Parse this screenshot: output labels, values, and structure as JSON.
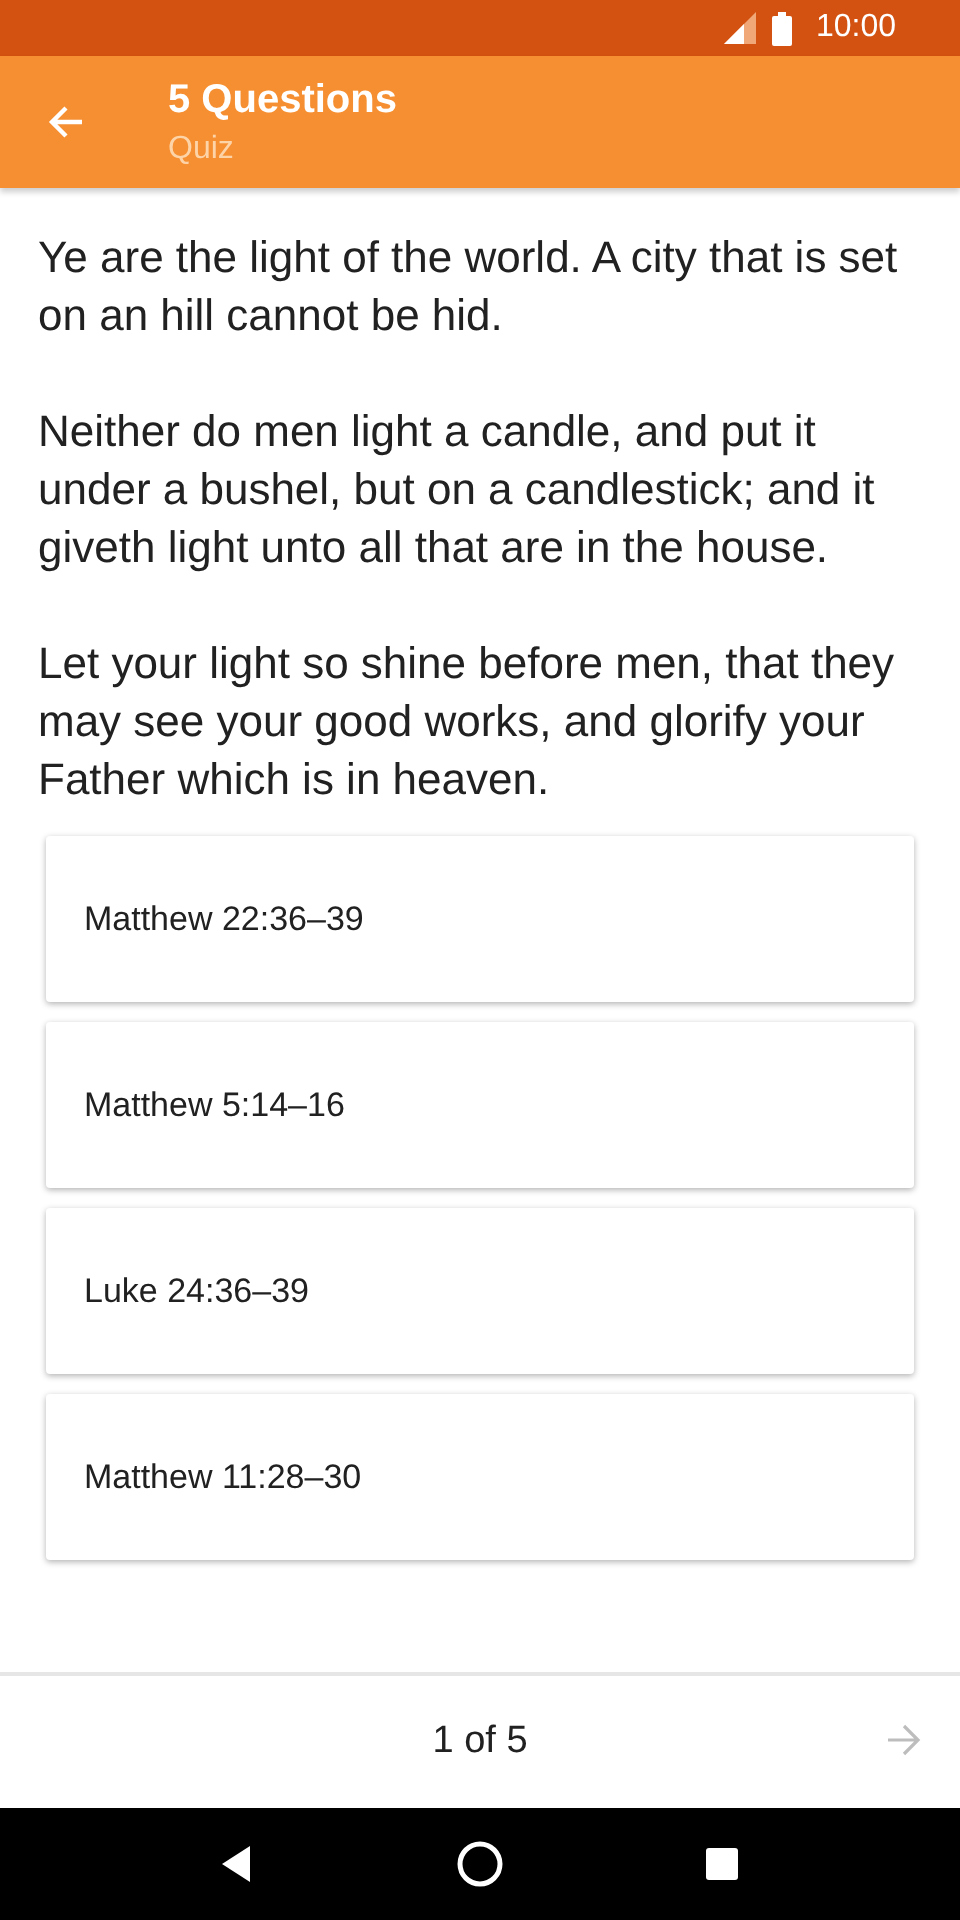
{
  "status_bar": {
    "time": "10:00"
  },
  "app_bar": {
    "title": "5 Questions",
    "subtitle": "Quiz"
  },
  "passage": [
    "Ye are the light of the world. A city that is set on an hill cannot be hid.",
    "Neither do men light a candle, and put it under a bushel, but on a candlestick; and it giveth light unto all that are in the house.",
    "Let your light so shine before men, that they may see your good works, and glorify your Father which is in heaven."
  ],
  "answers": [
    {
      "label": "Matthew 22:36–39"
    },
    {
      "label": "Matthew 5:14–16"
    },
    {
      "label": "Luke 24:36–39"
    },
    {
      "label": "Matthew 11:28–30"
    }
  ],
  "footer": {
    "progress": "1 of 5",
    "next_disabled": true
  }
}
